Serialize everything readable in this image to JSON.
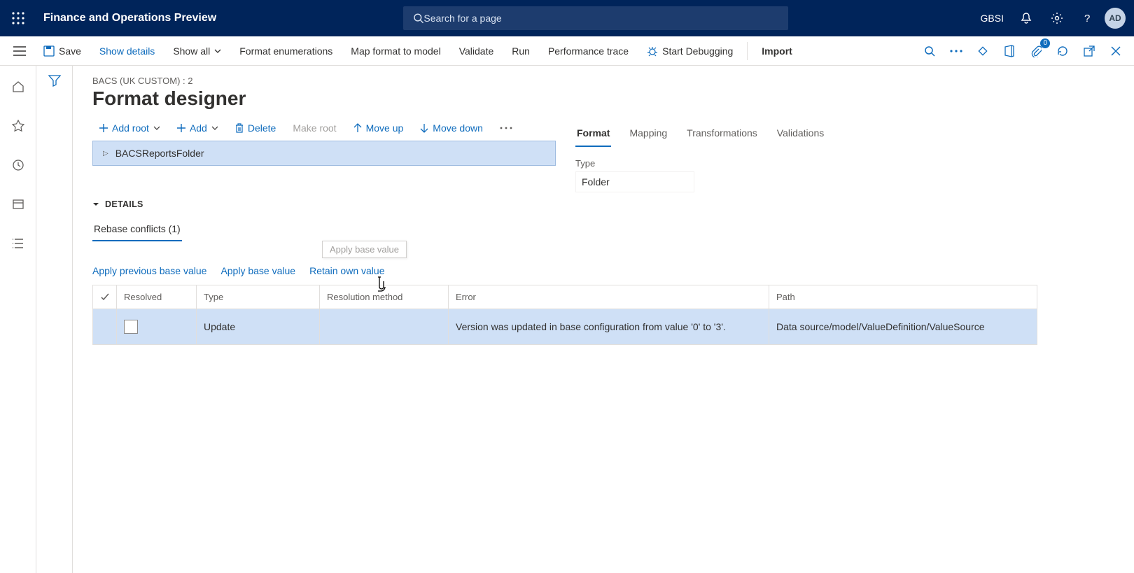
{
  "header": {
    "app_title": "Finance and Operations Preview",
    "search_placeholder": "Search for a page",
    "company": "GBSI",
    "avatar_initials": "AD"
  },
  "command_bar": {
    "save": "Save",
    "show_details": "Show details",
    "show_all": "Show all",
    "format_enum": "Format enumerations",
    "map_format": "Map format to model",
    "validate": "Validate",
    "run": "Run",
    "perf_trace": "Performance trace",
    "start_debug": "Start Debugging",
    "import": "Import",
    "attach_badge": "0"
  },
  "page": {
    "breadcrumb": "BACS (UK CUSTOM) : 2",
    "title": "Format designer"
  },
  "tree_toolbar": {
    "add_root": "Add root",
    "add": "Add",
    "delete": "Delete",
    "make_root": "Make root",
    "move_up": "Move up",
    "move_down": "Move down"
  },
  "tree": {
    "root_label": "BACSReportsFolder"
  },
  "prop_tabs": {
    "format": "Format",
    "mapping": "Mapping",
    "transformations": "Transformations",
    "validations": "Validations"
  },
  "props": {
    "type_label": "Type",
    "type_value": "Folder"
  },
  "details": {
    "header": "DETAILS",
    "subtab": "Rebase conflicts (1)",
    "tooltip_ghost": "Apply base value",
    "actions": {
      "apply_prev": "Apply previous base value",
      "apply_base": "Apply base value",
      "retain_own": "Retain own value"
    }
  },
  "table": {
    "cols": {
      "resolved": "Resolved",
      "type": "Type",
      "method": "Resolution method",
      "error": "Error",
      "path": "Path"
    },
    "rows": [
      {
        "resolved": false,
        "type": "Update",
        "method": "",
        "error": "Version was updated in base configuration from value '0' to '3'.",
        "path": "Data source/model/ValueDefinition/ValueSource"
      }
    ]
  }
}
